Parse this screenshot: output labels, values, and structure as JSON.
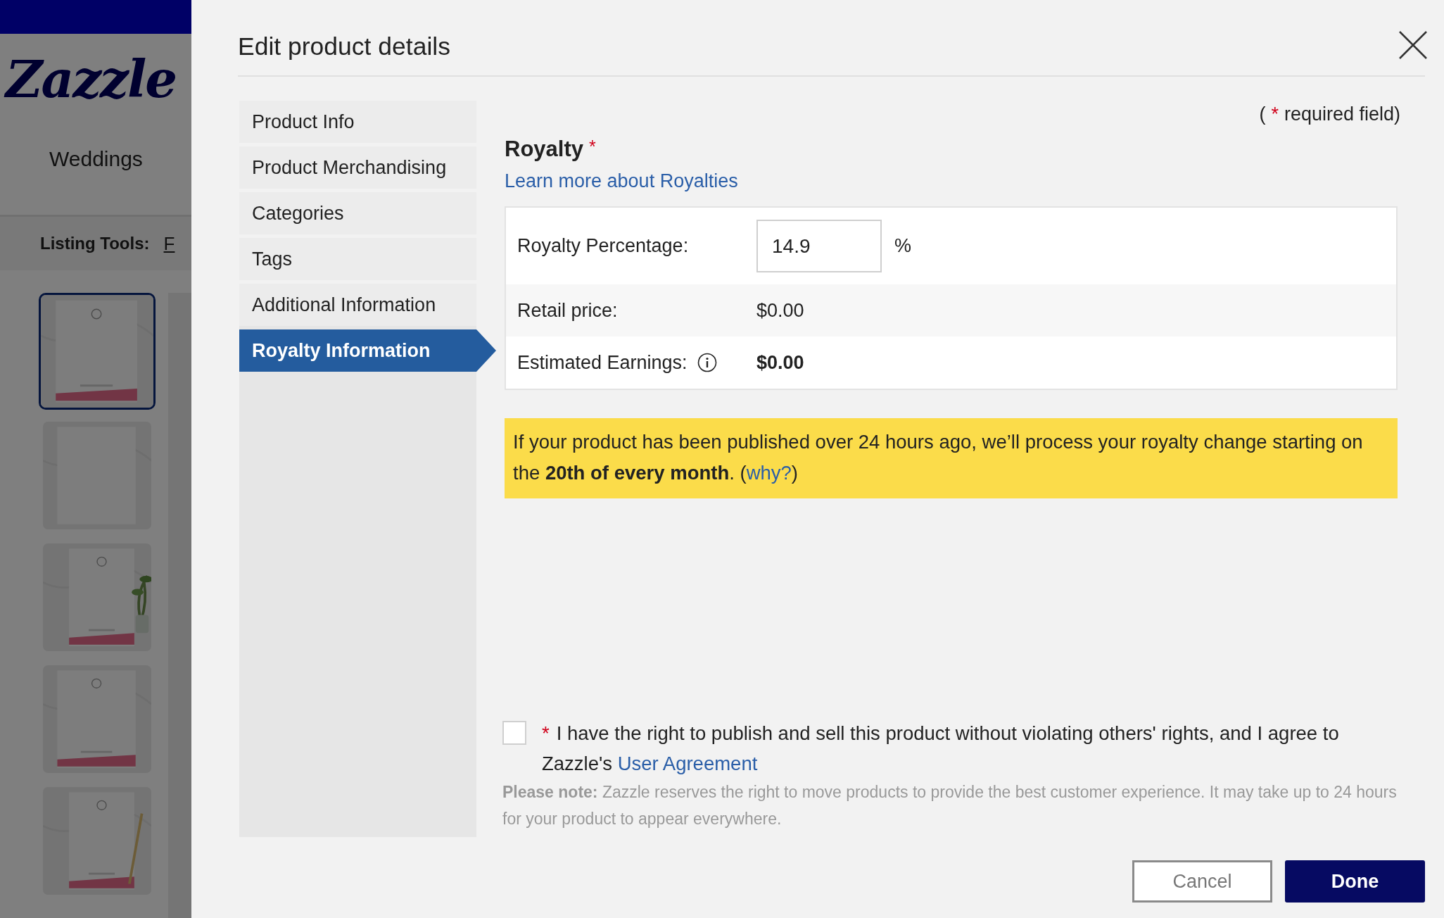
{
  "background_page": {
    "logo": "Zazzle",
    "nav_item": "Weddings",
    "listing_tools_label": "Listing Tools:",
    "listing_tools_link": "F",
    "thumbnails": [
      {
        "kind": "picture",
        "selected": true
      },
      {
        "kind": "picture",
        "selected": false
      },
      {
        "kind": "picture",
        "selected": false
      },
      {
        "kind": "picture",
        "selected": false
      },
      {
        "kind": "picture",
        "selected": false
      }
    ]
  },
  "dialog": {
    "title": "Edit product details",
    "tabs": [
      {
        "label": "Product Info",
        "selected": false
      },
      {
        "label": "Product Merchandising",
        "selected": false
      },
      {
        "label": "Categories",
        "selected": false
      },
      {
        "label": "Tags",
        "selected": false
      },
      {
        "label": "Additional Information",
        "selected": false
      },
      {
        "label": "Royalty Information",
        "selected": true
      }
    ],
    "required_note": {
      "open": "(",
      "asterisk": "*",
      "text": "required field)"
    },
    "section_title": "Royalty",
    "section_asterisk": "*",
    "learn_more_link": "Learn more about Royalties",
    "rows": [
      {
        "kind": "input",
        "label": "Royalty Percentage:",
        "value": "14.9",
        "unit": "%"
      },
      {
        "kind": "text",
        "label": "Retail price:",
        "value": "$0.00"
      },
      {
        "kind": "info",
        "label": "Estimated Earnings:",
        "value": "$0.00"
      }
    ],
    "banner": {
      "text": "If your product has been published over 24 hours ago, we’ll process your royalty change starting on the **20th of every month**. (",
      "link": "why?",
      "after": ")"
    },
    "agreement": {
      "checked": false,
      "asterisk": "*",
      "text": "I have the right to publish and sell this product without violating others' rights, and I agree to Zazzle's ",
      "link": "User Agreement"
    },
    "note": "**Please note:** Zazzle reserves the right to move products to provide the best customer experience. It may take up to 24 hours for your product to appear everywhere.",
    "buttons": [
      {
        "kind": "secondary",
        "label": "Cancel"
      },
      {
        "kind": "primary",
        "label": "Done"
      }
    ]
  }
}
